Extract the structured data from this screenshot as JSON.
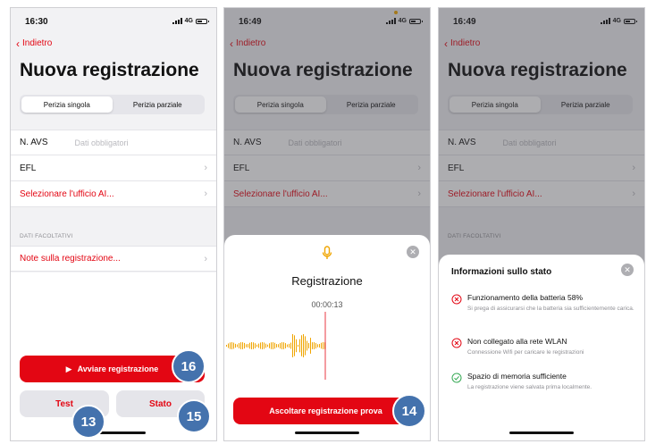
{
  "screens": [
    {
      "time": "16:30",
      "network": "4G",
      "back_label": "Indietro",
      "title": "Nuova registrazione",
      "segments": [
        "Perizia singola",
        "Perizia parziale"
      ],
      "rows": {
        "avs_label": "N. AVS",
        "avs_placeholder": "Dati obbligatori",
        "efl": "EFL",
        "office": "Selezionare l'ufficio AI..."
      },
      "optional_header": "DATI FACOLTATIVI",
      "notes": "Note sulla registrazione...",
      "start_button": "Avviare registrazione",
      "test_button": "Test",
      "status_button": "Stato",
      "badges": [
        "16",
        "13",
        "15"
      ]
    },
    {
      "time": "16:49",
      "network": "4G",
      "back_label": "Indietro",
      "title": "Nuova registrazione",
      "segments": [
        "Perizia singola",
        "Perizia parziale"
      ],
      "rows": {
        "avs_label": "N. AVS",
        "avs_placeholder": "Dati obbligatori",
        "efl": "EFL",
        "office": "Selezionare l'ufficio AI..."
      },
      "sheet": {
        "title": "Registrazione",
        "elapsed": "00:00:13",
        "play_button": "Ascoltare registrazione prova",
        "badge": "14"
      }
    },
    {
      "time": "16:49",
      "network": "4G",
      "back_label": "Indietro",
      "title": "Nuova registrazione",
      "segments": [
        "Perizia singola",
        "Perizia parziale"
      ],
      "rows": {
        "avs_label": "N. AVS",
        "avs_placeholder": "Dati obbligatori",
        "efl": "EFL",
        "office": "Selezionare l'ufficio AI..."
      },
      "optional_header": "DATI FACOLTATIVI",
      "sheet": {
        "title": "Informazioni sullo stato",
        "items": [
          {
            "status": "error",
            "title": "Funzionamento della batteria 58%",
            "subtitle": "Si prega di assicurarsi che la batteria sia sufficientemente carica."
          },
          {
            "status": "error",
            "title": "Non collegato alla rete WLAN",
            "subtitle": "Connessione Wifi per caricare le registrazioni"
          },
          {
            "status": "ok",
            "title": "Spazio di memoria sufficiente",
            "subtitle": "La registrazione viene salvata prima localmente."
          }
        ]
      }
    }
  ],
  "colors": {
    "accent": "#e30613",
    "badge": "#4472ad",
    "ok": "#34a853",
    "error": "#e30613"
  }
}
